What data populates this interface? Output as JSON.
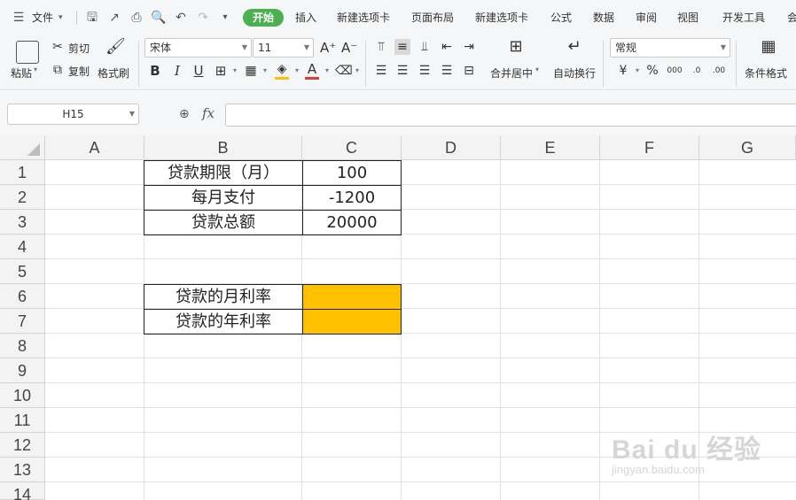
{
  "menubar": {
    "file": "文件",
    "tabs": [
      "开始",
      "插入",
      "新建选项卡",
      "页面布局",
      "新建选项卡",
      "公式",
      "数据",
      "审阅",
      "视图",
      "开发工具",
      "会"
    ]
  },
  "ribbon": {
    "paste": "粘贴",
    "cut": "剪切",
    "copy": "复制",
    "format_painter": "格式刷",
    "font_name": "宋体",
    "font_size": "11",
    "merge_center": "合并居中",
    "wrap_text": "自动换行",
    "number_format": "常规",
    "conditional_format": "条件格式",
    "colors": {
      "fill": "#ffc000",
      "font": "#e53935"
    }
  },
  "formula_bar": {
    "name_box": "H15",
    "fx": "fx",
    "value": ""
  },
  "sheet": {
    "columns": [
      "A",
      "B",
      "C",
      "D",
      "E",
      "F",
      "G"
    ],
    "rows": [
      "1",
      "2",
      "3",
      "4",
      "5",
      "6",
      "7",
      "8",
      "9",
      "10",
      "11",
      "12",
      "13",
      "14"
    ],
    "cells": {
      "B1": "贷款期限（月）",
      "C1": "100",
      "B2": "每月支付",
      "C2": "-1200",
      "B3": "贷款总额",
      "C3": "20000",
      "B6": "贷款的月利率",
      "C6": "",
      "B7": "贷款的年利率",
      "C7": ""
    },
    "highlight_color": "#ffc000"
  },
  "watermark": {
    "line1": "Bai du 经验",
    "line2": "jingyan.baidu.com"
  }
}
